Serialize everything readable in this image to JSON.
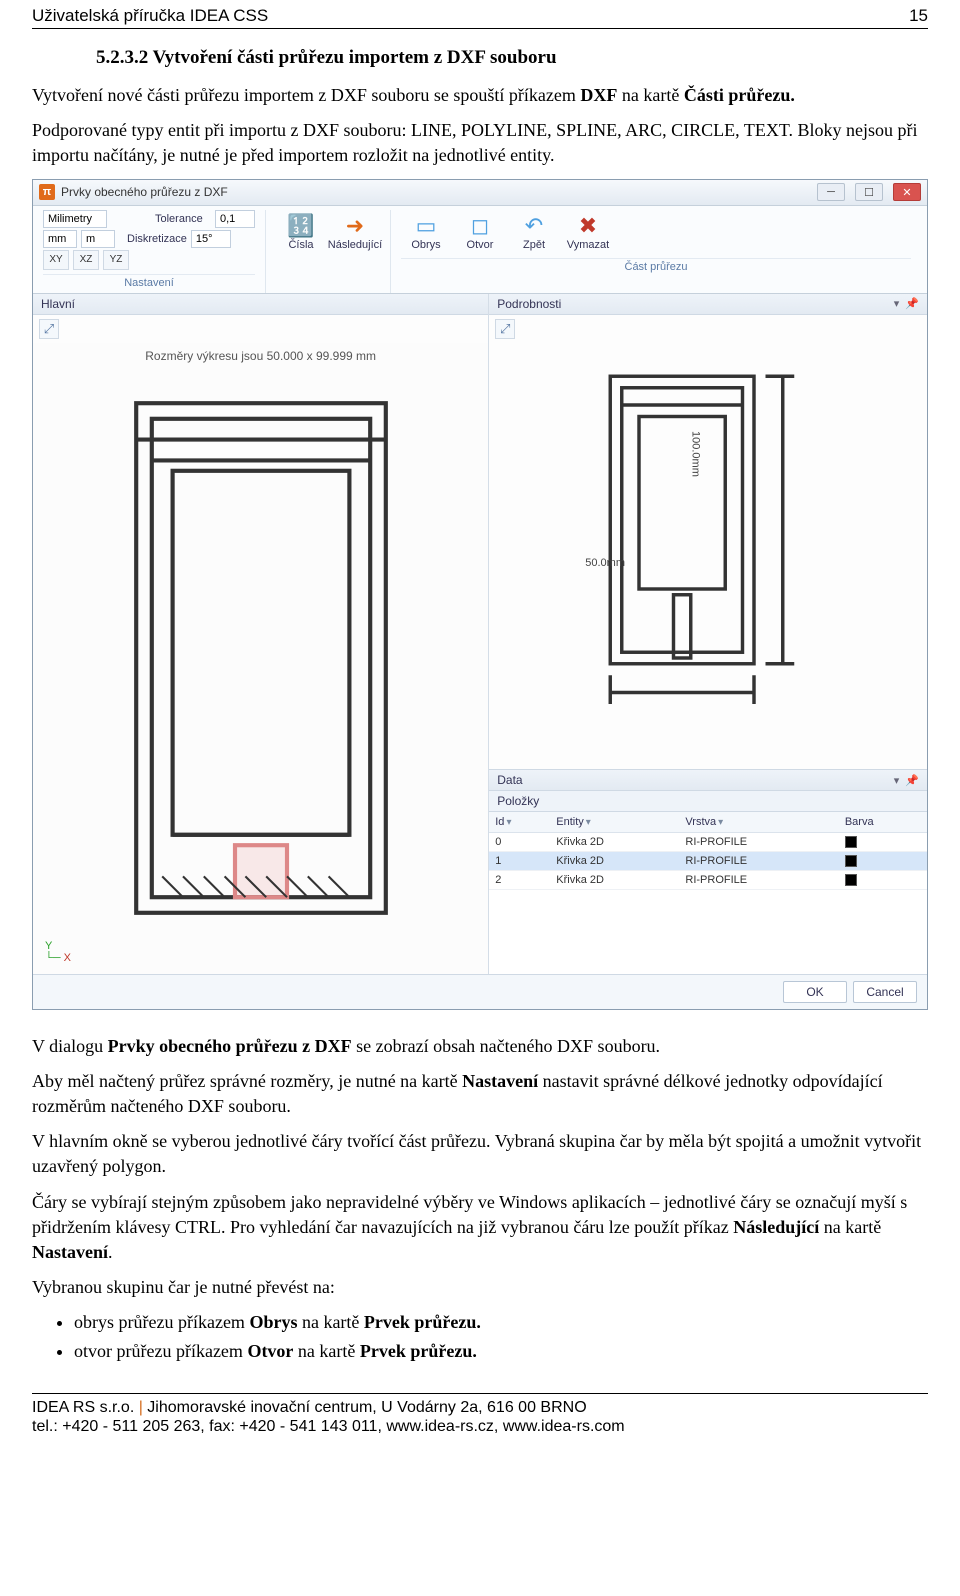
{
  "header": {
    "left": "Uživatelská příručka IDEA CSS",
    "page_number": "15"
  },
  "section": {
    "number": "5.2.3.2",
    "title": "Vytvoření části průřezu importem z DXF souboru"
  },
  "paragraphs": {
    "p1_a": "Vytvoření nové části průřezu importem z DXF souboru se spouští příkazem ",
    "p1_b": "DXF",
    "p1_c": " na kartě ",
    "p1_d": "Části průřezu.",
    "p2": "Podporované typy entit při importu z DXF souboru: LINE, POLYLINE, SPLINE, ARC, CIRCLE, TEXT. Bloky nejsou při importu načítány, je nutné je před importem rozložit na jednotlivé entity.",
    "p3_a": "V dialogu ",
    "p3_b": "Prvky obecného průřezu z DXF",
    "p3_c": " se zobrazí obsah načteného DXF souboru.",
    "p4_a": "Aby měl načtený průřez správné rozměry, je nutné na kartě ",
    "p4_b": "Nastavení",
    "p4_c": " nastavit správné délkové jednotky odpovídající rozměrům načteného DXF souboru.",
    "p5": "V hlavním okně se vyberou jednotlivé čáry tvořící část průřezu. Vybraná skupina čar by měla být spojitá a umožnit vytvořit uzavřený polygon.",
    "p6_a": "Čáry se vybírají stejným způsobem jako nepravidelné výběry ve Windows aplikacích – jednotlivé čáry se označují myší s přidržením klávesy CTRL. Pro vyhledání čar navazujících na již vybranou čáru lze použít příkaz ",
    "p6_b": "Následující",
    "p6_c": " na kartě ",
    "p6_d": "Nastavení",
    "p6_e": ".",
    "p7": "Vybranou skupinu čar je nutné převést na:",
    "bullets": [
      {
        "pre": "obrys průřezu příkazem ",
        "b1": "Obrys",
        "mid": " na kartě ",
        "b2": "Prvek průřezu."
      },
      {
        "pre": "otvor průřezu příkazem ",
        "b1": "Otvor",
        "mid": " na kartě ",
        "b2": "Prvek průřezu."
      }
    ]
  },
  "window": {
    "title": "Prvky obecného průřezu z DXF",
    "ribbon": {
      "units_label": "Milimetry",
      "mm1": "mm",
      "mm2": "m",
      "axis": [
        "XY",
        "XZ",
        "YZ"
      ],
      "tol_label": "Tolerance",
      "tol_value": "0,1",
      "disc_label": "Diskretizace",
      "disc_value": "15°",
      "buttons": {
        "cisla": "Čísla",
        "nasledujici": "Následující",
        "obrys": "Obrys",
        "otvor": "Otvor",
        "zpet": "Zpět",
        "vymazat": "Vymazat"
      },
      "group_left_caption": "Nastavení",
      "group_right_caption": "Část průřezu"
    },
    "main_panel": {
      "title": "Hlavní",
      "dim_text": "Rozměry výkresu jsou 50.000 x 99.999 mm",
      "ax_y": "Y",
      "ax_x": "X"
    },
    "detail_panel": {
      "title": "Podrobnosti",
      "dim_h": "50.0mm",
      "dim_v": "100.0mm"
    },
    "data_panel": {
      "title": "Data",
      "subtab": "Položky",
      "columns": {
        "id": "Id",
        "entity": "Entity",
        "layer": "Vrstva",
        "color": "Barva"
      },
      "rows": [
        {
          "id": "0",
          "entity": "Křivka 2D",
          "layer": "RI-PROFILE",
          "color": "#000"
        },
        {
          "id": "1",
          "entity": "Křivka 2D",
          "layer": "RI-PROFILE",
          "color": "#000"
        },
        {
          "id": "2",
          "entity": "Křivka 2D",
          "layer": "RI-PROFILE",
          "color": "#000"
        }
      ],
      "selected_index": 1
    },
    "footer": {
      "ok": "OK",
      "cancel": "Cancel"
    }
  },
  "footer": {
    "line1_a": "IDEA RS s.r.o. ",
    "line1_b": "|",
    "line1_c": " Jihomoravské inovační centrum, U Vodárny 2a, 616 00 BRNO",
    "line2": "tel.: +420 - 511 205 263, fax: +420 - 541 143 011, www.idea-rs.cz, www.idea-rs.com"
  }
}
